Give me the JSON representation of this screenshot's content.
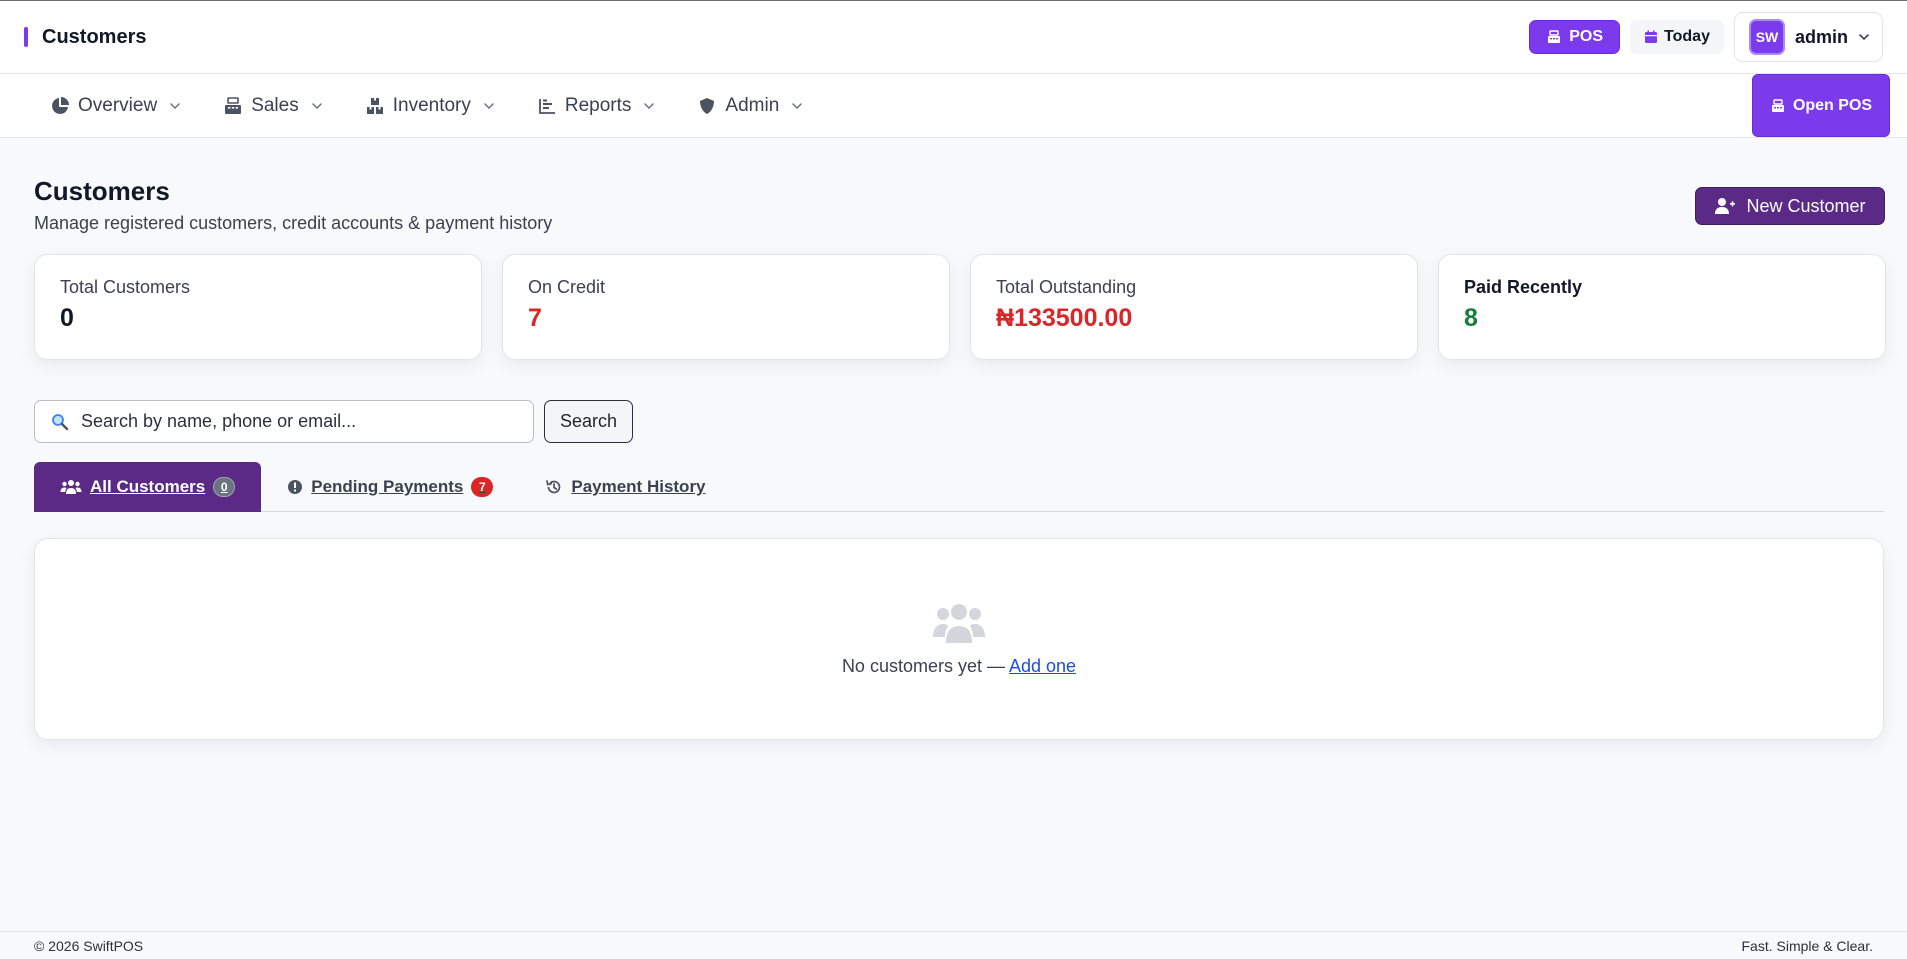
{
  "app": {
    "page_title": "Customers",
    "pos_label": "POS",
    "today_label": "Today",
    "user_initials": "SW",
    "username": "admin"
  },
  "nav": {
    "items": [
      {
        "label": "Overview",
        "icon": "pie-chart-icon"
      },
      {
        "label": "Sales",
        "icon": "cash-register-icon"
      },
      {
        "label": "Inventory",
        "icon": "boxes-icon"
      },
      {
        "label": "Reports",
        "icon": "bar-chart-icon"
      },
      {
        "label": "Admin",
        "icon": "shield-icon"
      }
    ],
    "open_pos_label": "Open POS"
  },
  "header": {
    "title": "Customers",
    "subtitle": "Manage registered customers, credit accounts & payment history",
    "new_customer_label": "New Customer"
  },
  "stats": [
    {
      "label": "Total Customers",
      "value": "0",
      "color": "#111827"
    },
    {
      "label": "On Credit",
      "value": "7",
      "color": "#dc2626"
    },
    {
      "label": "Total Outstanding",
      "value": "₦133500.00",
      "color": "#dc2626"
    },
    {
      "label": "Paid Recently",
      "value": "8",
      "color": "#15803d"
    }
  ],
  "search": {
    "placeholder": "Search by name, phone or email...",
    "value": "",
    "button_label": "Search"
  },
  "tabs": [
    {
      "label": "All Customers",
      "badge": "0",
      "active": true,
      "icon": "users-icon"
    },
    {
      "label": "Pending Payments",
      "badge": "7",
      "active": false,
      "icon": "alert-circle-icon"
    },
    {
      "label": "Payment History",
      "badge": "",
      "active": false,
      "icon": "history-icon"
    }
  ],
  "empty_state": {
    "text": "No customers yet —",
    "link": "Add one",
    "icon": "users-icon"
  },
  "footer": {
    "left": "© 2026 SwiftPOS",
    "right": "Fast. Simple & Clear."
  },
  "colors": {
    "brand": "#7c3aed",
    "brand_dark": "#5b2a86",
    "danger": "#dc2626",
    "success": "#15803d"
  }
}
